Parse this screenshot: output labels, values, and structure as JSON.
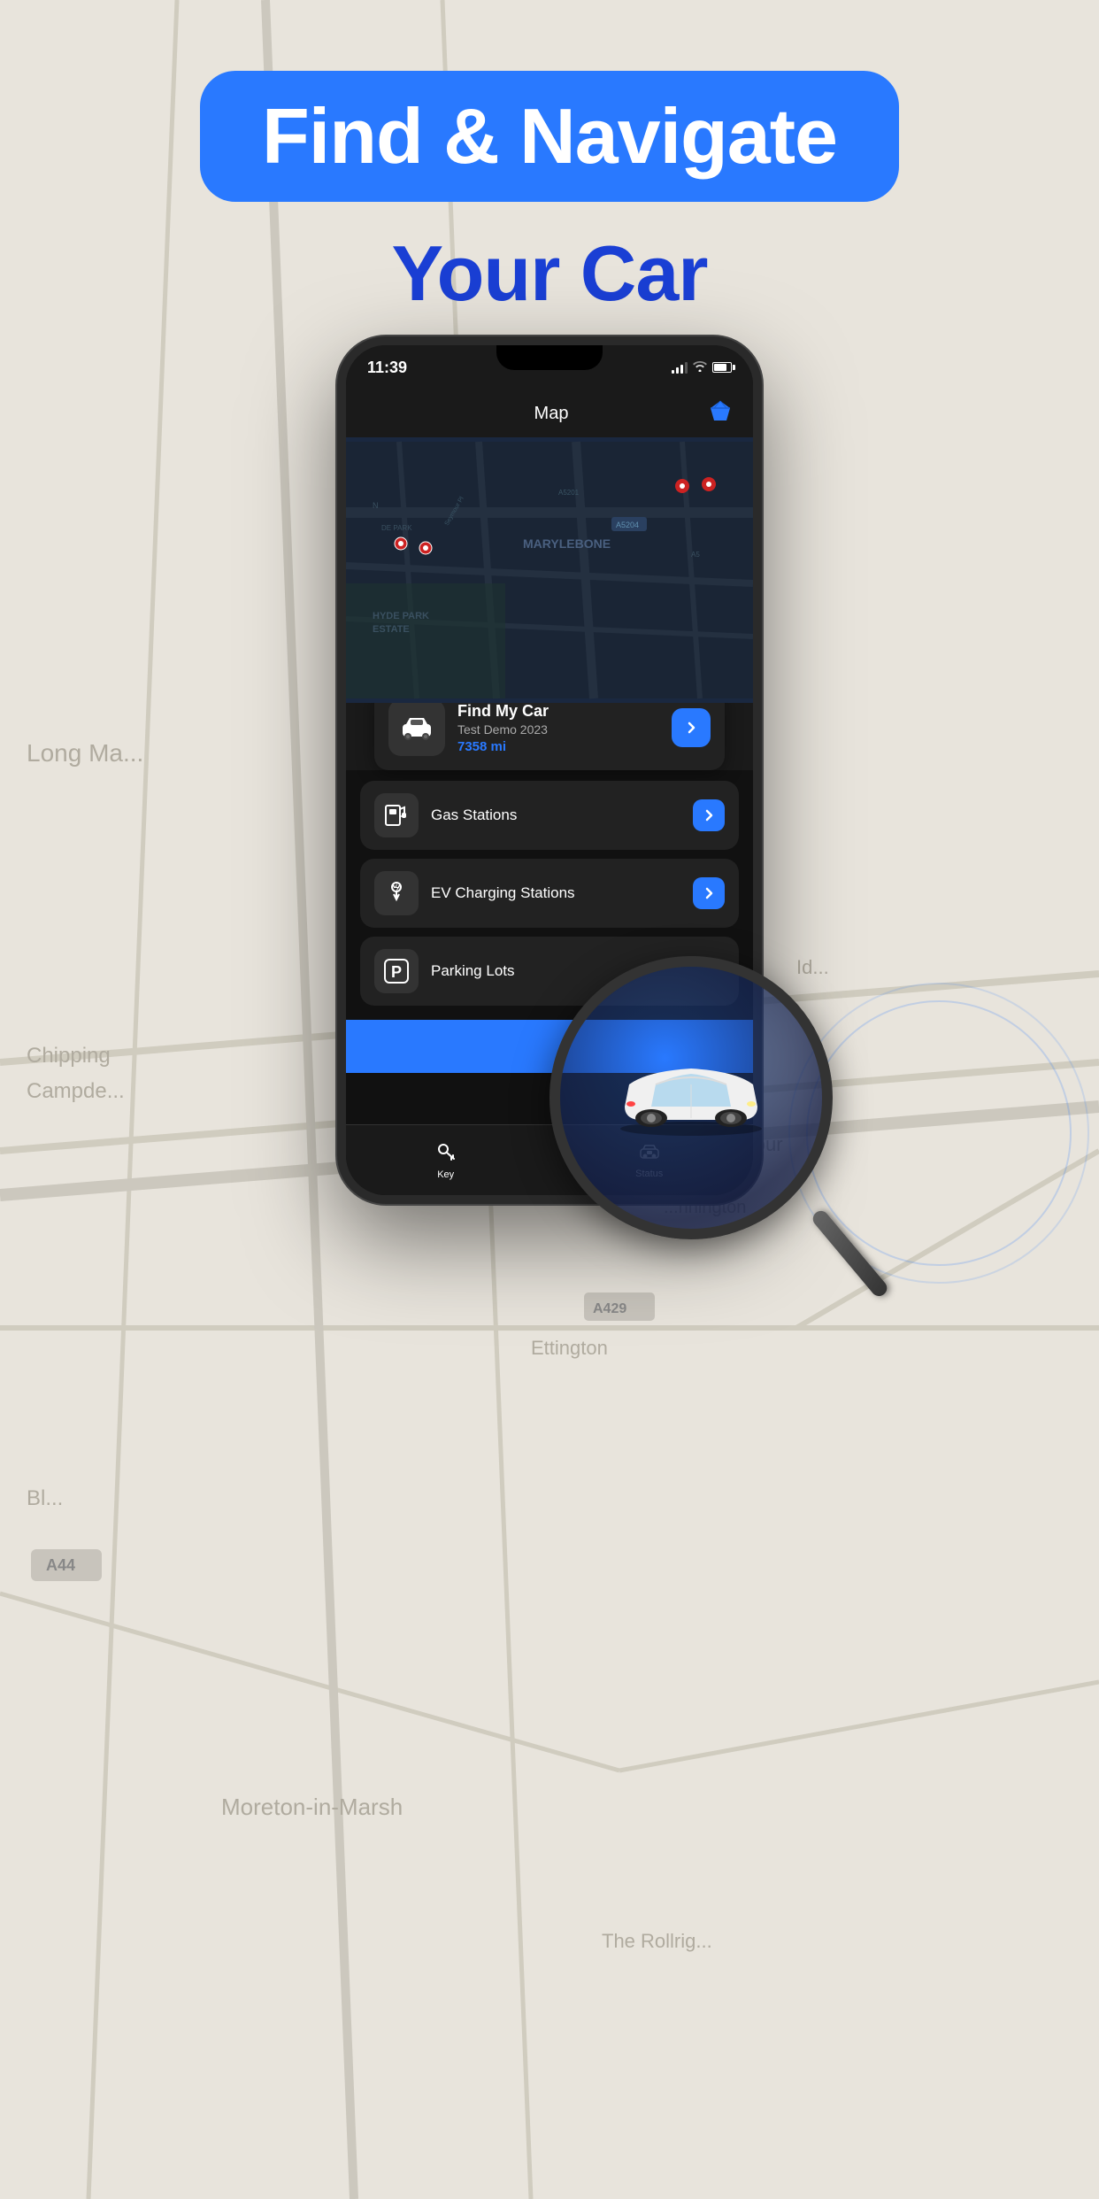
{
  "page": {
    "background_color": "#f0ede8"
  },
  "header": {
    "headline_line1": "Find & Navigate",
    "headline_line2": "Your Car"
  },
  "phone": {
    "status_bar": {
      "time": "11:39",
      "signal": "●●●",
      "wifi": "wifi",
      "battery": "80%"
    },
    "app_header": {
      "title": "Map",
      "premium_icon": "◆"
    },
    "find_my_car": {
      "title": "Find My Car",
      "subtitle": "Test Demo 2023",
      "distance": "7358 mi",
      "arrow_label": ">"
    },
    "menu_items": [
      {
        "id": "gas-stations",
        "label": "Gas Stations",
        "icon": "gas"
      },
      {
        "id": "ev-charging",
        "label": "EV Charging Stations",
        "icon": "ev"
      },
      {
        "id": "parking",
        "label": "Parking Lots",
        "icon": "parking"
      }
    ],
    "tab_bar": {
      "tabs": [
        {
          "id": "key",
          "label": "Key",
          "icon": "🔑",
          "active": true
        },
        {
          "id": "status",
          "label": "Status",
          "icon": "🚗",
          "active": false
        }
      ]
    }
  }
}
